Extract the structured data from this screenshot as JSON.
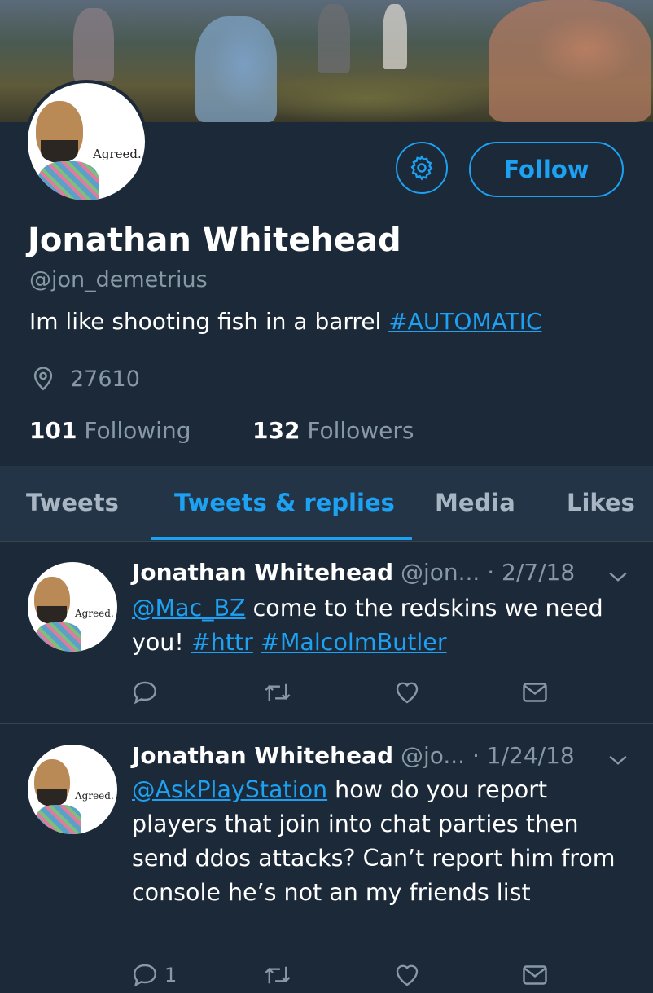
{
  "profile": {
    "name": "Jonathan Whitehead",
    "handle": "@jon_demetrius",
    "bio_text": "Im like shooting fish in a barrel ",
    "bio_hashtag": "#AUTOMATIC",
    "location": "27610",
    "following_count": "101",
    "following_label": " Following",
    "followers_count": "132",
    "followers_label": " Followers",
    "avatar_caption": "Agreed."
  },
  "buttons": {
    "follow_label": "Follow"
  },
  "tabs": [
    {
      "label": "Tweets",
      "active": false
    },
    {
      "label": "Tweets & replies",
      "active": true
    },
    {
      "label": "Media",
      "active": false
    },
    {
      "label": "Likes",
      "active": false
    }
  ],
  "tweets": [
    {
      "author": "Jonathan Whitehead",
      "handle": "@jon...",
      "date": "· 2/7/18",
      "mention": "@Mac_BZ",
      "text_after_mention": " come to the redskins we need you! ",
      "hashtag1": "#httr",
      "hashtag2": "#MalcolmButler",
      "reply_count": ""
    },
    {
      "author": "Jonathan Whitehead",
      "handle": "@jo...",
      "date": "· 1/24/18",
      "mention": "@AskPlayStation",
      "text_after_mention": " how do you report players that join into chat parties then send ddos attacks? Can’t report him from console he’s not an my friends list",
      "reply_count": "1"
    }
  ],
  "colors": {
    "background": "#1c2938",
    "accent": "#1da1f2",
    "muted": "#8899a6",
    "tab_bar": "#243447"
  },
  "icons": [
    "gear-icon",
    "location-pin-icon",
    "chevron-down-icon",
    "reply-icon",
    "retweet-icon",
    "like-icon",
    "direct-message-icon"
  ]
}
